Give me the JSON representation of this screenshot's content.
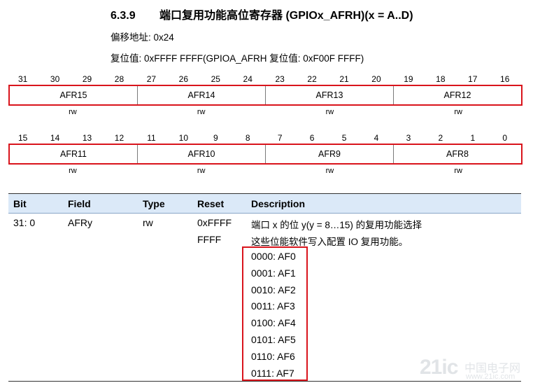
{
  "section": {
    "number": "6.3.9",
    "title": "端口复用功能高位寄存器 (GPIOx_AFRH)(x = A..D)"
  },
  "offset": "偏移地址: 0x24",
  "reset_value": "复位值: 0xFFFF FFFF(GPIOA_AFRH 复位值: 0xF00F FFFF)",
  "upper_bits": [
    "31",
    "30",
    "29",
    "28",
    "27",
    "26",
    "25",
    "24",
    "23",
    "22",
    "21",
    "20",
    "19",
    "18",
    "17",
    "16"
  ],
  "upper_fields": [
    "AFR15",
    "AFR14",
    "AFR13",
    "AFR12"
  ],
  "lower_bits": [
    "15",
    "14",
    "13",
    "12",
    "11",
    "10",
    "9",
    "8",
    "7",
    "6",
    "5",
    "4",
    "3",
    "2",
    "1",
    "0"
  ],
  "lower_fields": [
    "AFR11",
    "AFR10",
    "AFR9",
    "AFR8"
  ],
  "access": "rw",
  "table": {
    "headers": {
      "bit": "Bit",
      "field": "Field",
      "type": "Type",
      "reset": "Reset",
      "description": "Description"
    },
    "row": {
      "bit": "31: 0",
      "field": "AFRy",
      "type": "rw",
      "reset_line1": "0xFFFF",
      "reset_line2": "FFFF",
      "desc_line1": "端口 x 的位 y(y = 8…15) 的复用功能选择",
      "desc_line2": "这些位能软件写入配置 IO 复用功能。",
      "options": [
        "0000: AF0",
        "0001: AF1",
        "0010: AF2",
        "0011: AF3",
        "0100: AF4",
        "0101: AF5",
        "0110: AF6",
        "0111: AF7"
      ]
    }
  },
  "watermark": {
    "logo": "21ic",
    "cn": "中国电子网",
    "url": "www.21ic.com"
  }
}
